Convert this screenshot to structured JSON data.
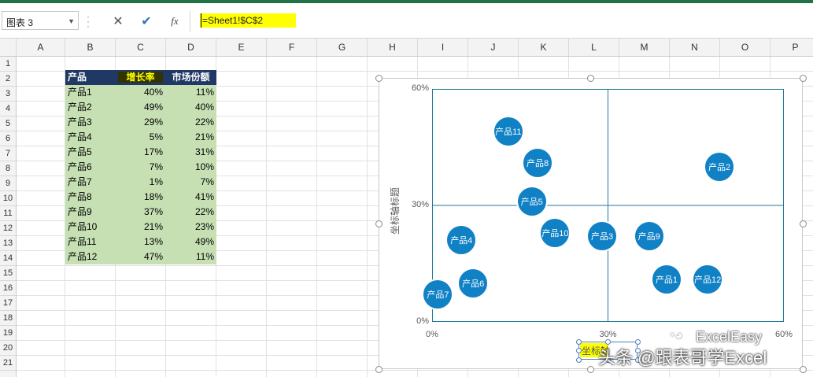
{
  "namebox": {
    "value": "图表 3"
  },
  "formula": {
    "cancel": "✕",
    "enter": "✔",
    "fx": "fx",
    "value": "=Sheet1!$C$2"
  },
  "columns": [
    "A",
    "B",
    "C",
    "D",
    "E",
    "F",
    "G",
    "H",
    "I",
    "J",
    "K",
    "L",
    "M",
    "N",
    "O",
    "P"
  ],
  "rows": [
    "1",
    "2",
    "3",
    "4",
    "5",
    "6",
    "7",
    "8",
    "9",
    "10",
    "11",
    "12",
    "13",
    "14",
    "15",
    "16",
    "17",
    "18",
    "19",
    "20",
    "21"
  ],
  "table": {
    "headers": [
      "产品",
      "增长率",
      "市场份额"
    ],
    "rows": [
      [
        "产品1",
        "40%",
        "11%"
      ],
      [
        "产品2",
        "49%",
        "40%"
      ],
      [
        "产品3",
        "29%",
        "22%"
      ],
      [
        "产品4",
        "5%",
        "21%"
      ],
      [
        "产品5",
        "17%",
        "31%"
      ],
      [
        "产品6",
        "7%",
        "10%"
      ],
      [
        "产品7",
        "1%",
        "7%"
      ],
      [
        "产品8",
        "18%",
        "41%"
      ],
      [
        "产品9",
        "37%",
        "22%"
      ],
      [
        "产品10",
        "21%",
        "23%"
      ],
      [
        "产品11",
        "13%",
        "49%"
      ],
      [
        "产品12",
        "47%",
        "11%"
      ]
    ]
  },
  "chart_data": {
    "type": "scatter",
    "ylabel": "坐标轴标题",
    "xlabel": "坐标轴",
    "xlim": [
      0,
      0.6
    ],
    "ylim": [
      0,
      0.6
    ],
    "x_ticks": [
      "0%",
      "30%",
      "60%"
    ],
    "y_ticks": [
      "0%",
      "30%",
      "60%"
    ],
    "points": [
      {
        "label": "产品1",
        "x": 0.4,
        "y": 0.11
      },
      {
        "label": "产品2",
        "x": 0.49,
        "y": 0.4
      },
      {
        "label": "产品3",
        "x": 0.29,
        "y": 0.22
      },
      {
        "label": "产品4",
        "x": 0.05,
        "y": 0.21
      },
      {
        "label": "产品5",
        "x": 0.17,
        "y": 0.31
      },
      {
        "label": "产品6",
        "x": 0.07,
        "y": 0.1
      },
      {
        "label": "产品7",
        "x": 0.01,
        "y": 0.07
      },
      {
        "label": "产品8",
        "x": 0.18,
        "y": 0.41
      },
      {
        "label": "产品9",
        "x": 0.37,
        "y": 0.22
      },
      {
        "label": "产品10",
        "x": 0.21,
        "y": 0.23
      },
      {
        "label": "产品11",
        "x": 0.13,
        "y": 0.49
      },
      {
        "label": "产品12",
        "x": 0.47,
        "y": 0.11
      }
    ],
    "colors": {
      "bubble": "#1081c5",
      "plot_border": "#1f7a99",
      "header_bg": "#1f3864",
      "cell_bg": "#c6e0b4"
    }
  },
  "watermark": {
    "line1": "ExcelEasy",
    "line2": "头条 @跟表哥学Excel"
  }
}
